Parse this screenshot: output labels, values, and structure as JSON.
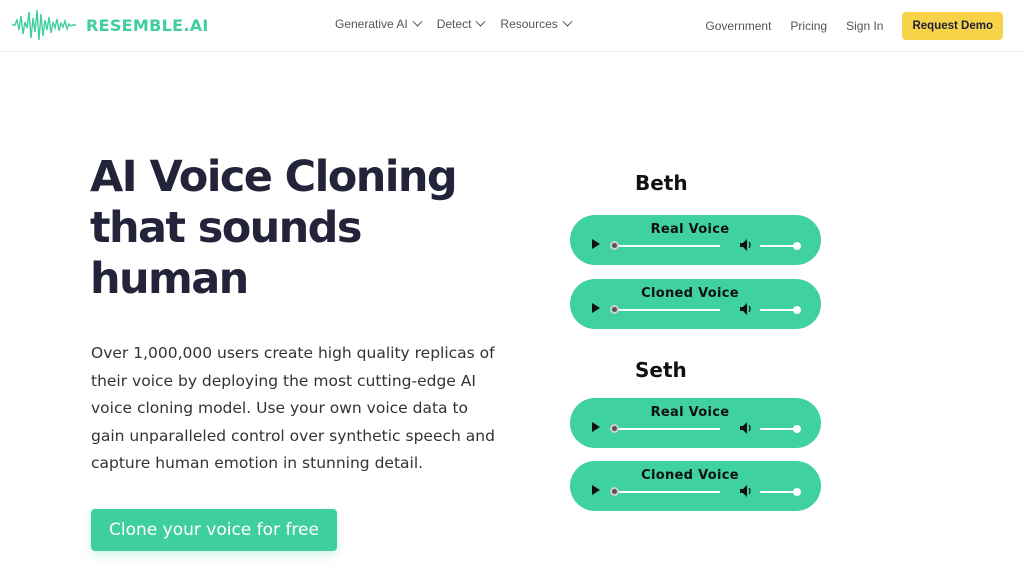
{
  "brand": {
    "name": "RESEMBLE.AI",
    "color": "#3fcf9c"
  },
  "nav": {
    "menu": [
      {
        "label": "Generative AI"
      },
      {
        "label": "Detect"
      },
      {
        "label": "Resources"
      }
    ],
    "links": {
      "government": "Government",
      "pricing": "Pricing",
      "signin": "Sign In"
    },
    "demo_button": "Request Demo",
    "demo_color": "#f7d34a"
  },
  "hero": {
    "title_lines": [
      "AI Voice Cloning",
      "that sounds",
      "human"
    ],
    "description": "Over 1,000,000 users create high quality replicas of their voice by deploying the most cutting-edge AI voice cloning model. Use your own voice data to gain unparalleled control over synthetic speech  and capture human emotion in stunning detail.",
    "cta": "Clone your voice for free"
  },
  "samples": [
    {
      "speaker": "Beth",
      "players": [
        {
          "label": "Real Voice",
          "icons": [
            "play-icon",
            "volume-icon"
          ]
        },
        {
          "label": "Cloned Voice",
          "icons": [
            "play-icon",
            "volume-icon"
          ]
        }
      ]
    },
    {
      "speaker": "Seth",
      "players": [
        {
          "label": "Real Voice",
          "icons": [
            "play-icon",
            "volume-icon"
          ]
        },
        {
          "label": "Cloned Voice",
          "icons": [
            "play-icon",
            "volume-icon"
          ]
        }
      ]
    }
  ],
  "colors": {
    "player_bg": "#3fd19e",
    "title_text": "#23233a"
  }
}
